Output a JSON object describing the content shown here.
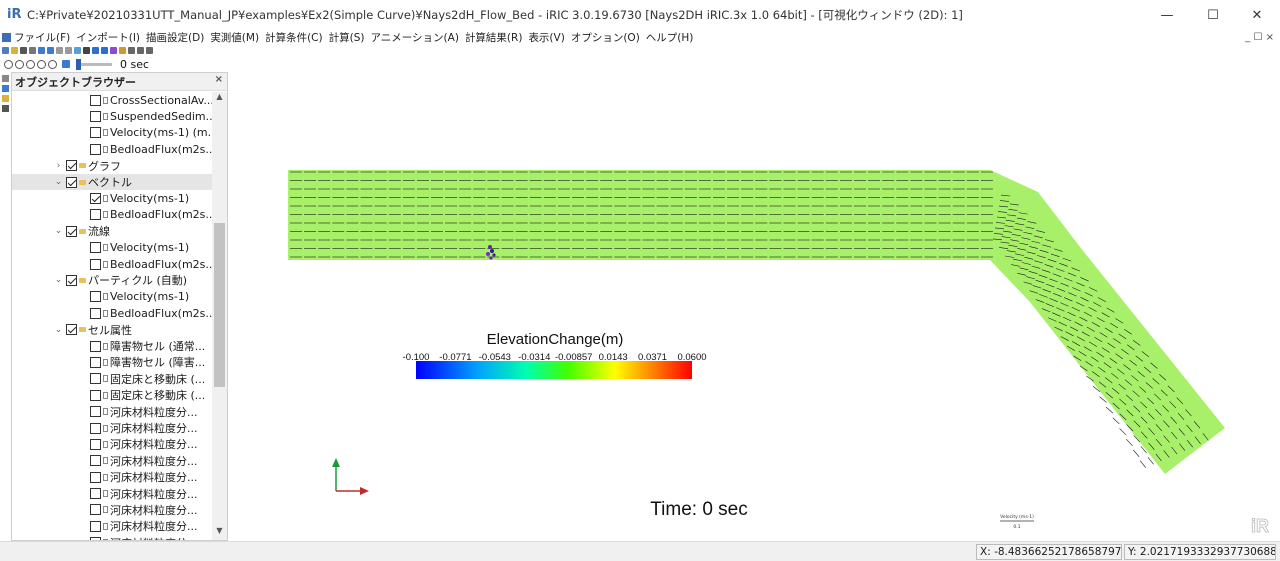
{
  "window": {
    "title": "C:¥Private¥20210331UTT_Manual_JP¥examples¥Ex2(Simple Curve)¥Nays2dH_Flow_Bed - iRIC 3.0.19.6730 [Nays2DH iRIC.3x 1.0 64bit] - [可視化ウィンドウ (2D): 1]",
    "logo": "iR",
    "minimize": "—",
    "maximize": "☐",
    "close": "✕"
  },
  "menu": [
    "ファイル(F)",
    "インポート(I)",
    "描画設定(D)",
    "実測値(M)",
    "計算条件(C)",
    "計算(S)",
    "アニメーション(A)",
    "計算結果(R)",
    "表示(V)",
    "オプション(O)",
    "ヘルプ(H)"
  ],
  "animation": {
    "time_text": "0 sec",
    "progress": 0
  },
  "object_browser": {
    "title": "オブジェクトブラウザー",
    "close": "×",
    "rows": [
      {
        "label": "CrossSectionalAv...",
        "level": 2,
        "checked": false,
        "kind": "leaf",
        "expander": ""
      },
      {
        "label": "SuspendedSedim...",
        "level": 2,
        "checked": false,
        "kind": "leaf",
        "expander": ""
      },
      {
        "label": "Velocity(ms-1) (m...",
        "level": 2,
        "checked": false,
        "kind": "leaf",
        "expander": ""
      },
      {
        "label": "BedloadFlux(m2s...",
        "level": 2,
        "checked": false,
        "kind": "leaf",
        "expander": ""
      },
      {
        "label": "グラフ",
        "level": 1,
        "checked": true,
        "kind": "folder",
        "expander": "›"
      },
      {
        "label": "ベクトル",
        "level": 1,
        "checked": true,
        "kind": "folder",
        "expander": "⌄",
        "selected": true
      },
      {
        "label": "Velocity(ms-1)",
        "level": 2,
        "checked": true,
        "kind": "leaf",
        "expander": ""
      },
      {
        "label": "BedloadFlux(m2s...",
        "level": 2,
        "checked": false,
        "kind": "leaf",
        "expander": ""
      },
      {
        "label": "流線",
        "level": 1,
        "checked": true,
        "kind": "folder",
        "expander": "⌄"
      },
      {
        "label": "Velocity(ms-1)",
        "level": 2,
        "checked": false,
        "kind": "leaf",
        "expander": ""
      },
      {
        "label": "BedloadFlux(m2s...",
        "level": 2,
        "checked": false,
        "kind": "leaf",
        "expander": ""
      },
      {
        "label": "パーティクル (自動)",
        "level": 1,
        "checked": true,
        "kind": "folder",
        "expander": "⌄"
      },
      {
        "label": "Velocity(ms-1)",
        "level": 2,
        "checked": false,
        "kind": "leaf",
        "expander": ""
      },
      {
        "label": "BedloadFlux(m2s...",
        "level": 2,
        "checked": false,
        "kind": "leaf",
        "expander": ""
      },
      {
        "label": "セル属性",
        "level": 1,
        "checked": true,
        "kind": "folder",
        "expander": "⌄"
      },
      {
        "label": "障害物セル (通常...",
        "level": 2,
        "checked": false,
        "kind": "leaf",
        "expander": ""
      },
      {
        "label": "障害物セル (障害...",
        "level": 2,
        "checked": false,
        "kind": "leaf",
        "expander": ""
      },
      {
        "label": "固定床と移動床 (...",
        "level": 2,
        "checked": false,
        "kind": "leaf",
        "expander": ""
      },
      {
        "label": "固定床と移動床 (...",
        "level": 2,
        "checked": false,
        "kind": "leaf",
        "expander": ""
      },
      {
        "label": "河床材料粒度分...",
        "level": 2,
        "checked": false,
        "kind": "leaf",
        "expander": ""
      },
      {
        "label": "河床材料粒度分...",
        "level": 2,
        "checked": false,
        "kind": "leaf",
        "expander": ""
      },
      {
        "label": "河床材料粒度分...",
        "level": 2,
        "checked": false,
        "kind": "leaf",
        "expander": ""
      },
      {
        "label": "河床材料粒度分...",
        "level": 2,
        "checked": false,
        "kind": "leaf",
        "expander": ""
      },
      {
        "label": "河床材料粒度分...",
        "level": 2,
        "checked": false,
        "kind": "leaf",
        "expander": ""
      },
      {
        "label": "河床材料粒度分...",
        "level": 2,
        "checked": false,
        "kind": "leaf",
        "expander": ""
      },
      {
        "label": "河床材料粒度分...",
        "level": 2,
        "checked": false,
        "kind": "leaf",
        "expander": ""
      },
      {
        "label": "河床材料粒度分...",
        "level": 2,
        "checked": false,
        "kind": "leaf",
        "expander": ""
      },
      {
        "label": "河床材料粒度分...",
        "level": 2,
        "checked": false,
        "kind": "leaf",
        "expander": ""
      }
    ]
  },
  "viewport": {
    "colorbar": {
      "title": "ElevationChange(m)",
      "ticks": [
        "-0.100",
        "-0.0771",
        "-0.0543",
        "-0.0314",
        "-0.00857",
        "0.0143",
        "0.0371",
        "0.0600"
      ]
    },
    "time_label": "Time: 0 sec",
    "scale_top": "Velocity (ms-1)",
    "scale_bottom": "0.1",
    "watermark": "iR",
    "grid_fill": "#a9f06a",
    "vector_color": "#1a1a1a"
  },
  "status": {
    "x": "X: -8.4836625217865879733",
    "y": "Y: 2.0217193332937730688"
  }
}
